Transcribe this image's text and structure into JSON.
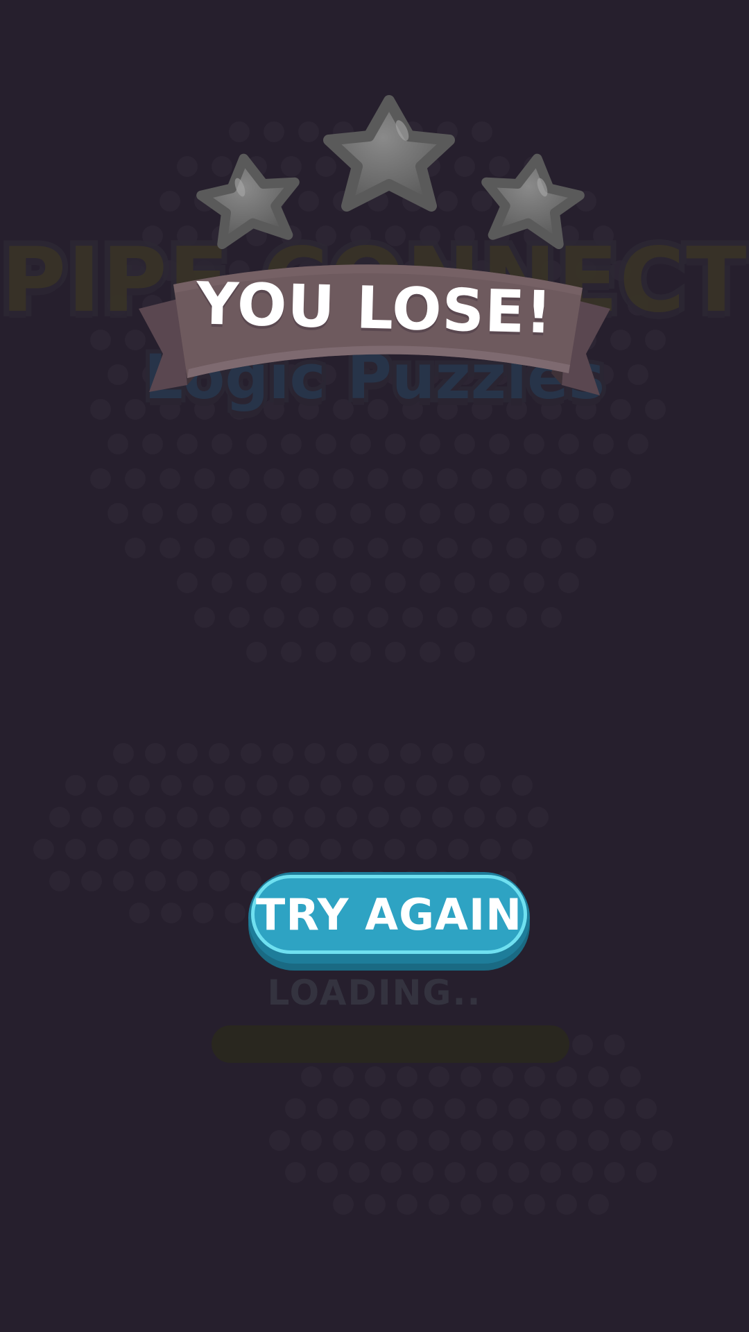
{
  "background": {
    "title": "PIPE CONNECT",
    "subtitle": "Logic Puzzles"
  },
  "result": {
    "banner_text": "YOU LOSE!",
    "stars_earned": 0,
    "stars_total": 3,
    "star_color_empty": "#6f6f6f",
    "ribbon_color": "#6e5a5e"
  },
  "actions": {
    "try_again_label": "TRY AGAIN",
    "button_color": "#2ea3c3"
  },
  "loading": {
    "label": "LOADING..",
    "progress": 0
  }
}
